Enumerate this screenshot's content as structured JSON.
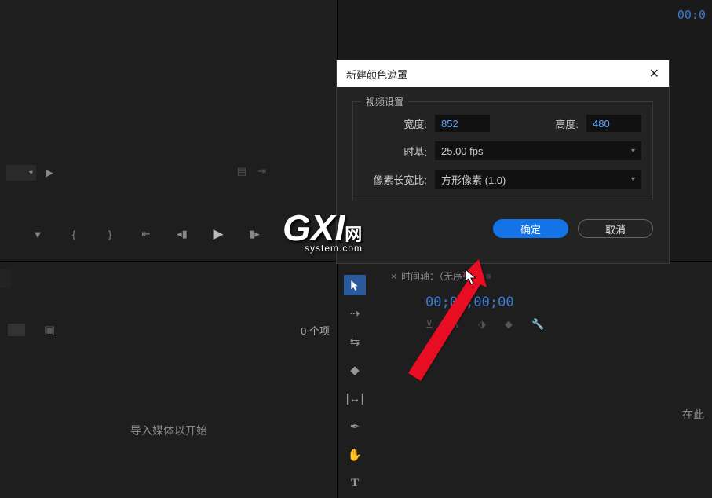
{
  "preview": {
    "timecode_right": "00:0"
  },
  "project": {
    "item_count": "0 个项",
    "drop_hint": "导入媒体以开始"
  },
  "dialog": {
    "title": "新建颜色遮罩",
    "fieldset_label": "视频设置",
    "width_label": "宽度:",
    "width_value": "852",
    "height_label": "高度:",
    "height_value": "480",
    "timebase_label": "时基:",
    "timebase_value": "25.00 fps",
    "par_label": "像素长宽比:",
    "par_value": "方形像素 (1.0)",
    "ok_label": "确定",
    "cancel_label": "取消"
  },
  "timeline": {
    "tab_label": "时间轴：（无序列）",
    "timecode": "00;00;00;00",
    "body_hint": "在此"
  },
  "watermark": {
    "main": "GXI",
    "suffix": "网",
    "sub": "system.com"
  }
}
